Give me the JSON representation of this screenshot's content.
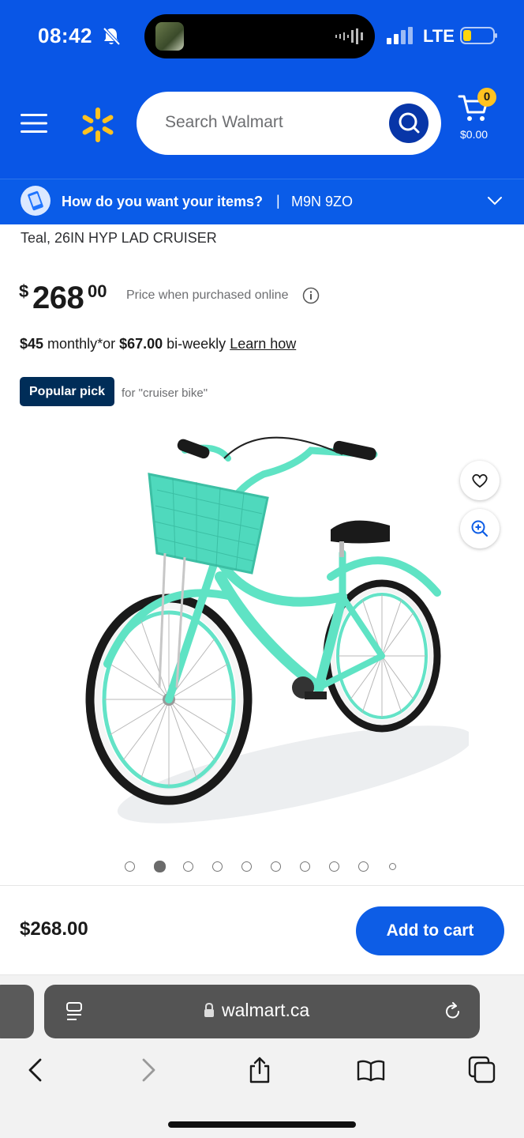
{
  "status_bar": {
    "time": "08:42",
    "network": "LTE",
    "icons": [
      "bell-slash-icon",
      "signal-icon",
      "battery-icon"
    ]
  },
  "header": {
    "logo": "walmart-spark-icon",
    "search_placeholder": "Search Walmart",
    "cart_count": "0",
    "cart_total": "$0.00"
  },
  "delivery": {
    "question": "How do you want your items?",
    "separator": "|",
    "postal_code": "M9N 9ZO"
  },
  "product": {
    "title": "Teal, 26IN HYP LAD CRUISER",
    "price_currency": "$",
    "price_dollars": "268",
    "price_cents": "00",
    "price_note": "Price when purchased online",
    "financing": {
      "monthly_amount": "$45",
      "monthly_text": " monthly*or ",
      "biweekly_amount": "$67.00",
      "biweekly_text": " bi-weekly ",
      "link": "Learn how"
    },
    "badge": "Popular pick",
    "badge_context": "for \"cruiser bike\"",
    "image_count": 10,
    "active_image_index": 1
  },
  "cart_bar": {
    "price": "$268.00",
    "button": "Add to cart"
  },
  "browser": {
    "url": "walmart.ca"
  },
  "colors": {
    "header_blue": "#0956e6",
    "walmart_yellow": "#ffc220",
    "badge_navy": "#002d58",
    "button_blue": "#0d5de6",
    "bike_teal": "#5fe3c4"
  }
}
